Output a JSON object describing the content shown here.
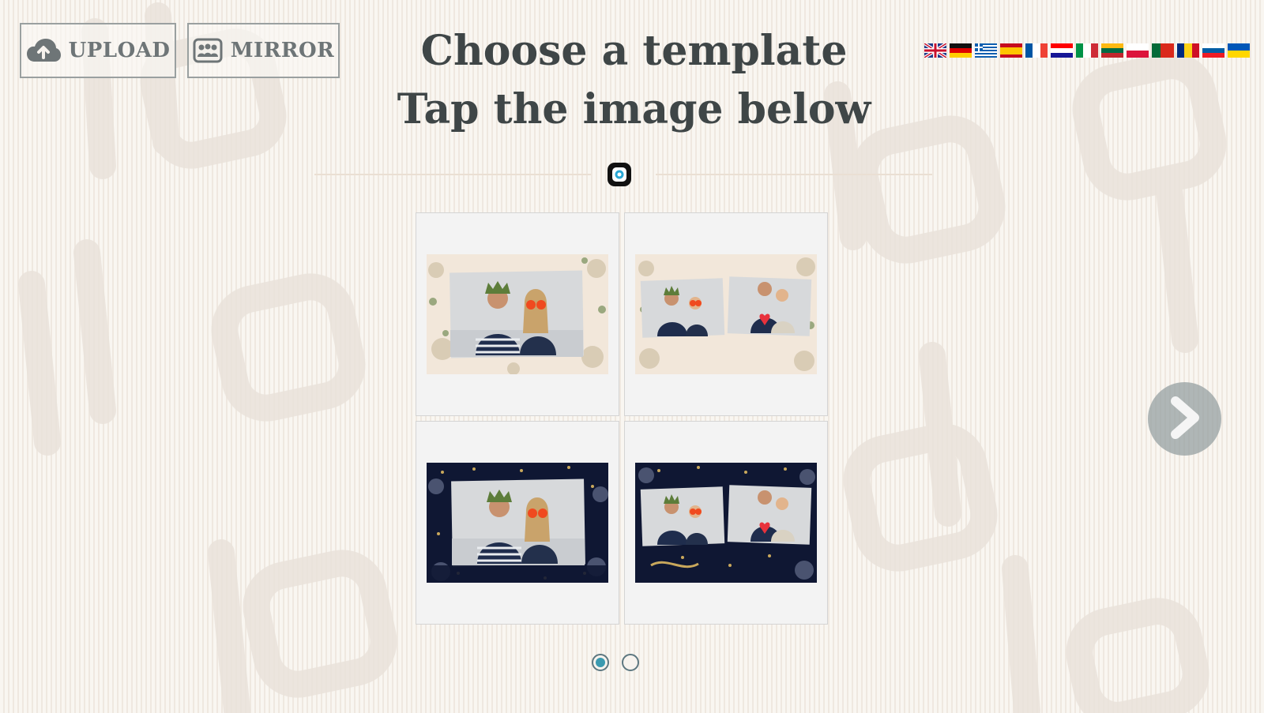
{
  "toolbar": {
    "upload_label": "UPLOAD",
    "mirror_label": "MIRROR",
    "upload_icon": "cloud-upload-icon",
    "mirror_icon": "mirror-icon"
  },
  "header": {
    "title_line1": "Choose a template",
    "title_line2": "Tap the image below"
  },
  "languages": [
    {
      "code": "en",
      "icon": "uk-flag-icon"
    },
    {
      "code": "de",
      "icon": "germany-flag-icon"
    },
    {
      "code": "el",
      "icon": "greece-flag-icon"
    },
    {
      "code": "es",
      "icon": "spain-flag-icon"
    },
    {
      "code": "fr",
      "icon": "france-flag-icon"
    },
    {
      "code": "hr",
      "icon": "croatia-flag-icon"
    },
    {
      "code": "it",
      "icon": "italy-flag-icon"
    },
    {
      "code": "lt",
      "icon": "lithuania-flag-icon"
    },
    {
      "code": "pl",
      "icon": "poland-flag-icon"
    },
    {
      "code": "pt",
      "icon": "portugal-flag-icon"
    },
    {
      "code": "ro",
      "icon": "romania-flag-icon"
    },
    {
      "code": "sl",
      "icon": "slovenia-flag-icon"
    },
    {
      "code": "uk",
      "icon": "ukraine-flag-icon"
    }
  ],
  "templates": [
    {
      "theme": "floral-cream",
      "photos": 1
    },
    {
      "theme": "floral-cream",
      "photos": 2
    },
    {
      "theme": "navy-gold-party",
      "photos": 1
    },
    {
      "theme": "navy-gold-party",
      "photos": 2
    }
  ],
  "pagination": {
    "total_pages": 2,
    "current_page": 1
  },
  "colors": {
    "text": "#3f4647",
    "button_text": "#6e7577",
    "accent": "#3b9ab0",
    "background": "#f7f3ee"
  }
}
